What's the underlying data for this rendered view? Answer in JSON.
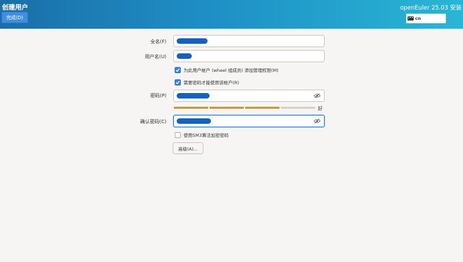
{
  "header": {
    "title": "创建用户",
    "done_label": "完成(D)",
    "product": "openEuler 25.03 安装",
    "keyboard_layout": "cn"
  },
  "form": {
    "fullname_label": "全名(F)",
    "username_label": "用户名(U)",
    "admin_checkbox_label": "为此用户帐户 (wheel 组成员) 添加管理权限(M)",
    "admin_checked": true,
    "require_password_label": "需要密码才能使用该帐户(R)",
    "require_password_checked": true,
    "password_label": "密码(P)",
    "password_strength_text": "好",
    "password_strength_level": 0.75,
    "confirm_label": "确认密码(C)",
    "sm3_label": "使用SM3算法加密密码",
    "sm3_checked": false,
    "advanced_label": "高级(A)..."
  },
  "colors": {
    "header_start": "#1c6ea8",
    "header_end": "#29b6d6",
    "accent": "#3584e4",
    "redaction": "#1561c2",
    "strength": "#c59a3a"
  }
}
